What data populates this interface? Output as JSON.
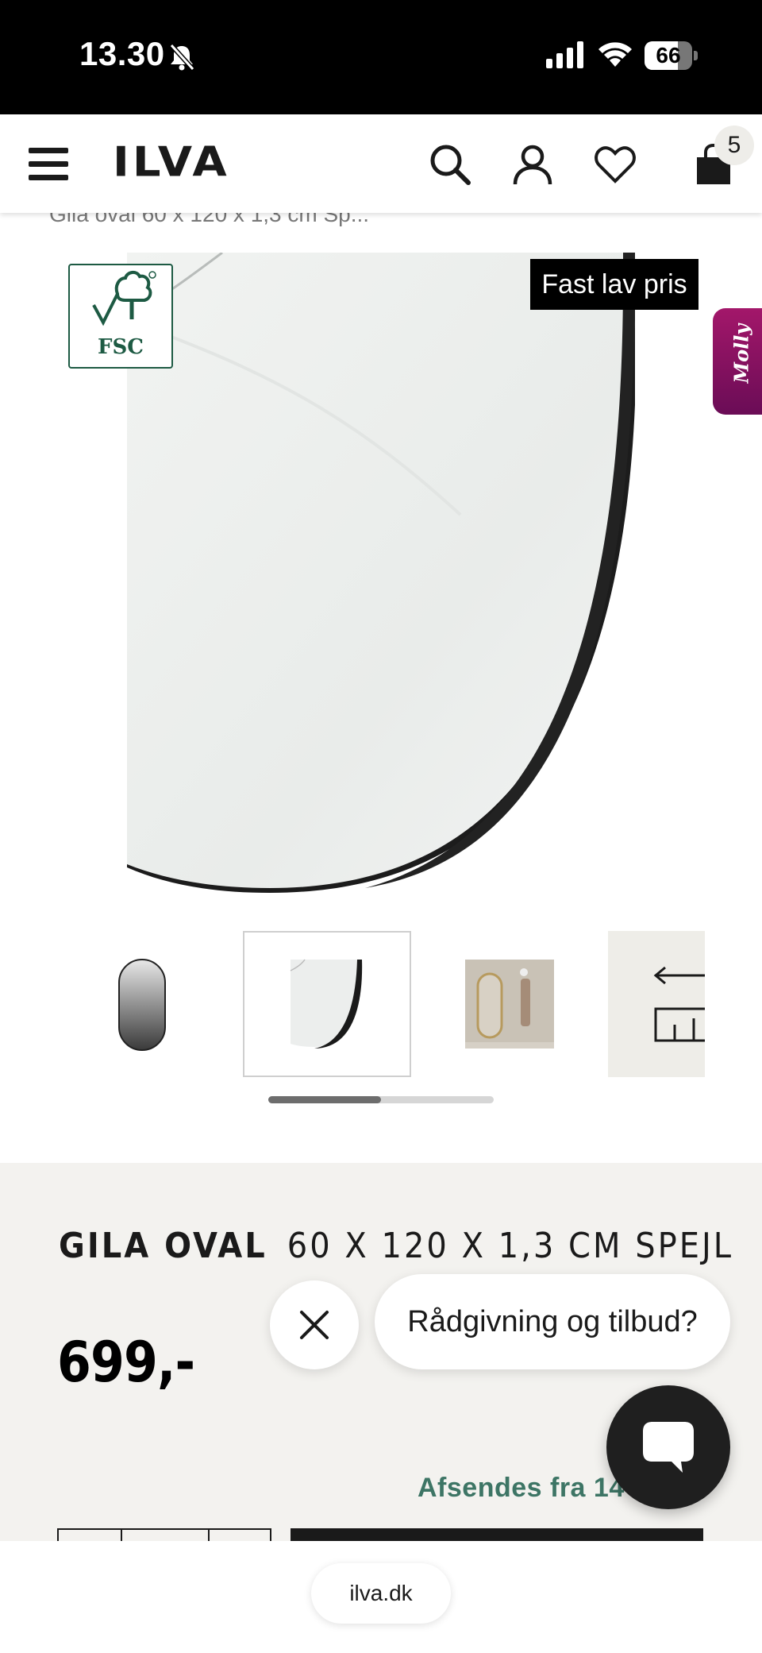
{
  "status_bar": {
    "time": "13.30",
    "battery": "66"
  },
  "header": {
    "logo": "ILVA",
    "cart_count": "5"
  },
  "breadcrumb": "Gila oval 60 x 120 x 1,3 cm Sp...",
  "gallery": {
    "badge": "Fast lav pris",
    "certification": "FSC",
    "side_tab": "Molly",
    "thumbnail_count": 4,
    "active_thumbnail": 2,
    "scroll_progress": 0.5
  },
  "product": {
    "brand": "GILA OVAL",
    "title_rest": "60 X 120 X 1,3 CM SPEJL",
    "price": "699,-",
    "shipping": "Afsendes fra 14-0"
  },
  "chat": {
    "prompt": "Rådgivning og tilbud?"
  },
  "browser": {
    "url": "ilva.dk"
  },
  "colors": {
    "accent_green": "#3d7565",
    "fsc_green": "#1d5a43",
    "molly_magenta": "#a3176a",
    "info_bg": "#f3f2ef"
  }
}
